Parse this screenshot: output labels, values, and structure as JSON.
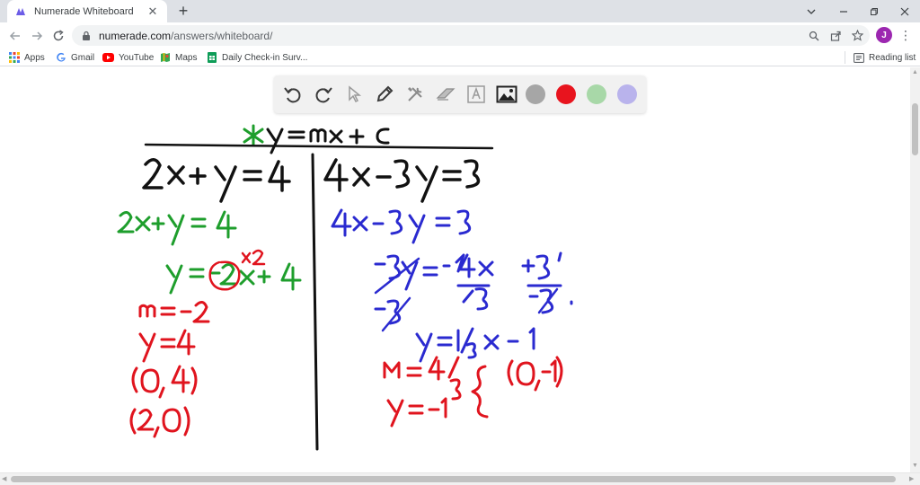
{
  "browser": {
    "tab_title": "Numerade Whiteboard",
    "tab_close": "✕",
    "new_tab": "+",
    "url_host": "numerade.com",
    "url_path": "/answers/whiteboard/",
    "avatar_letter": "J",
    "menu": "⋮"
  },
  "bookmarks": [
    {
      "label": "Apps",
      "icon": "apps-grid-icon"
    },
    {
      "label": "Gmail",
      "icon": "google-icon"
    },
    {
      "label": "YouTube",
      "icon": "youtube-icon"
    },
    {
      "label": "Maps",
      "icon": "maps-icon"
    },
    {
      "label": "Daily Check-in Surv...",
      "icon": "sheets-icon"
    }
  ],
  "reading_list": "Reading list",
  "whiteboard": {
    "tools": [
      "undo-icon",
      "redo-icon",
      "pointer-icon",
      "pen-icon",
      "tools-icon",
      "eraser-icon",
      "text-icon",
      "image-icon"
    ],
    "colors": [
      "#a6a6a6",
      "#e8141e",
      "#a8d8a8",
      "#b9b3ec"
    ],
    "ink": {
      "green": "#1e9e2c",
      "black": "#111111",
      "red": "#e0141e",
      "blue": "#2a2ad0"
    }
  }
}
